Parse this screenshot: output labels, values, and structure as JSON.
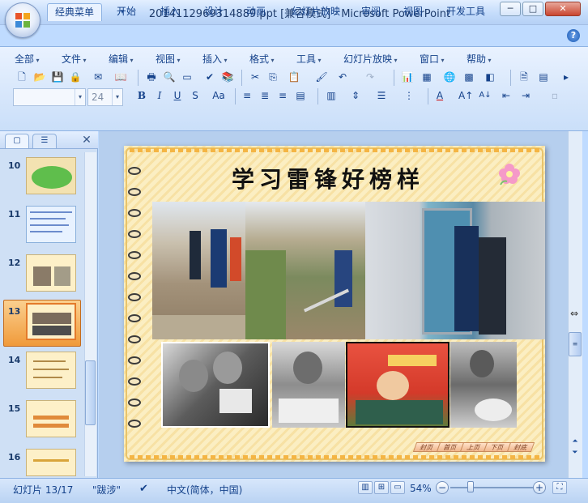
{
  "window": {
    "title": "2014112969314889.ppt [兼容模式] - Microsoft PowerPoint",
    "min_label": "─",
    "max_label": "□",
    "close_label": "✕"
  },
  "tabs": [
    {
      "label": "经典菜单",
      "active": true
    },
    {
      "label": "开始"
    },
    {
      "label": "插入"
    },
    {
      "label": "设计"
    },
    {
      "label": "动画"
    },
    {
      "label": "幻灯片放映"
    },
    {
      "label": "审阅"
    },
    {
      "label": "视图"
    },
    {
      "label": "开发工具"
    }
  ],
  "menus": [
    "全部",
    "文件",
    "编辑",
    "视图",
    "插入",
    "格式",
    "工具",
    "幻灯片放映",
    "窗口",
    "帮助"
  ],
  "font_size_value": "24",
  "slides_pane": {
    "numbers": [
      "10",
      "11",
      "12",
      "13",
      "14",
      "15",
      "16"
    ],
    "selected": "13"
  },
  "slide": {
    "title": "学习雷锋好榜样",
    "nav_buttons": [
      "封页",
      "首页",
      "上页",
      "下页",
      "封底"
    ]
  },
  "status": {
    "slide_count": "幻灯片 13/17",
    "theme": "\"跋涉\"",
    "language": "中文(简体，中国)",
    "zoom": "54%",
    "zoom_fraction": 0.54
  },
  "colors": {
    "accent": "#15428b",
    "selection": "#f09a3a",
    "slide_bg": "#fbeec2"
  }
}
